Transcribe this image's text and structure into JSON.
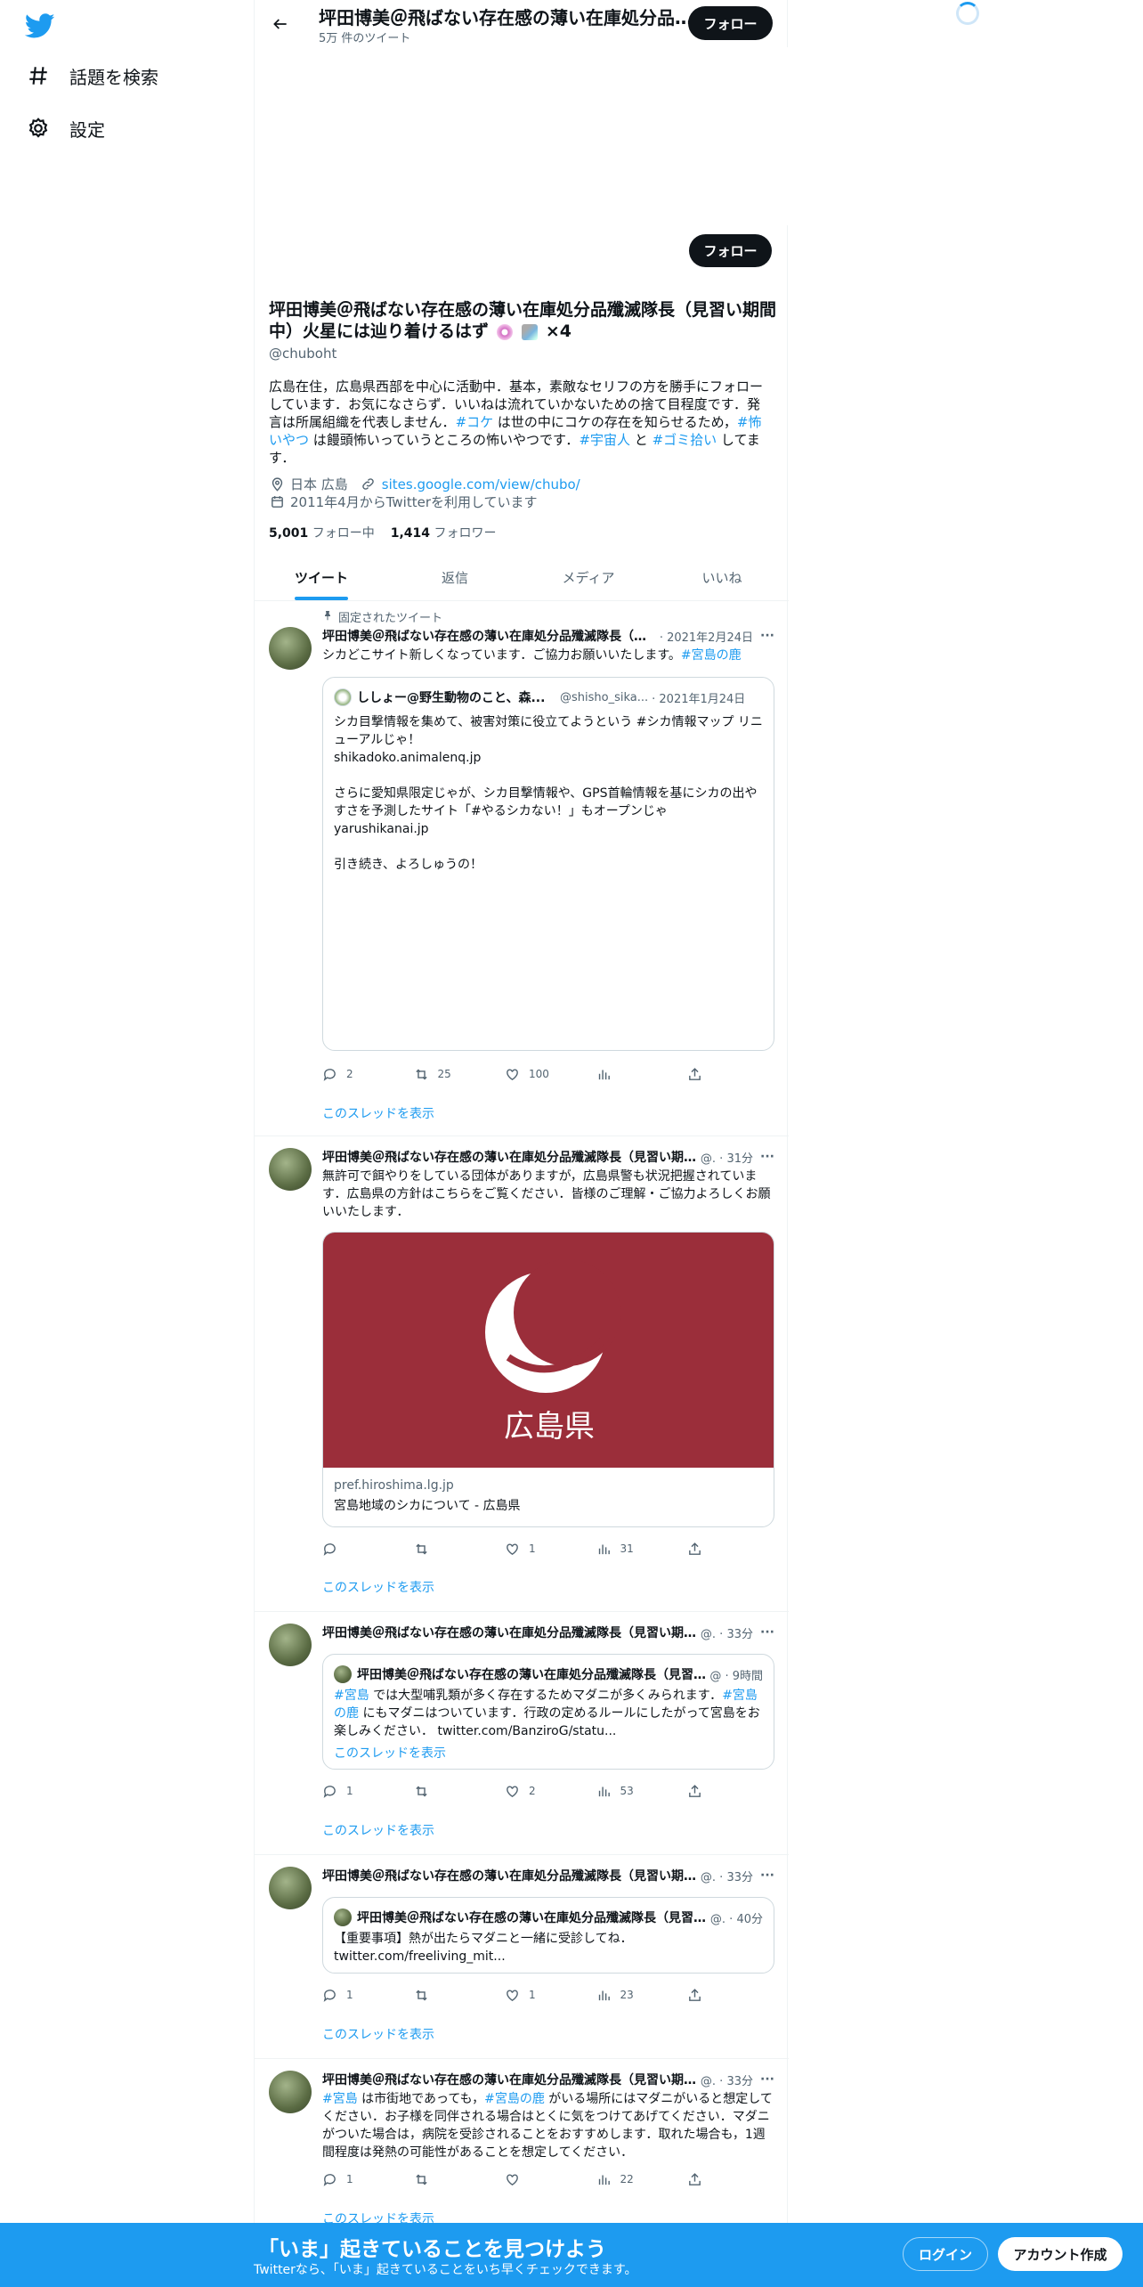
{
  "nav": {
    "logo": "twitter-bird-icon",
    "items": [
      {
        "icon": "hashtag-icon",
        "label": "話題を検索"
      },
      {
        "icon": "gear-icon",
        "label": "設定"
      }
    ]
  },
  "header": {
    "name": "坪田博美＠飛ばない存在感の薄い在庫処分品殲滅隊長（見習い期間中）火星には辿り着けるはず",
    "tweet_count": "5万 件のツイート",
    "follow_label": "フォロー"
  },
  "profile": {
    "name": "坪田博美＠飛ばない存在感の薄い在庫処分品殲滅隊長（見習い期間中）火星には辿り着けるはず",
    "name_suffix": "×4",
    "handle": "@chuboht",
    "follow_label": "フォロー",
    "bio": {
      "t1": "広島在住，広島県西部を中心に活動中．基本，素敵なセリフの方を勝手にフォローしています．お気になさらず．いいねは流れていかないための捨て目程度です．発言は所属組織を代表しません．",
      "tag1": "#コケ",
      "t2": " は世の中にコケの存在を知らせるため，",
      "tag2": "#怖いやつ",
      "t3": " は饅頭怖いっていうところの怖いやつです．",
      "tag3": "#宇宙人",
      "t4": " と ",
      "tag4": "#ゴミ拾い",
      "t5": " してます．"
    },
    "location": "日本 広島",
    "website": "sites.google.com/view/chubo/",
    "joined": "2011年4月からTwitterを利用しています",
    "following_count": "5,001",
    "following_label": "フォロー中",
    "followers_count": "1,414",
    "followers_label": "フォロワー"
  },
  "tabs": [
    "ツイート",
    "返信",
    "メディア",
    "いいね"
  ],
  "colors": {
    "accent": "#1d9bf0",
    "text": "#0f1419",
    "muted": "#536471",
    "card_red": "#9b2e3a"
  },
  "tweets": [
    {
      "pinned_label": "固定されたツイート",
      "name": "坪田博美＠飛ばない存在感の薄い在庫処分品殲滅隊長（見習い期間中）火星には辿り着けるはず",
      "time": "· 2021年2月24日",
      "text": "シカどこサイト新しくなっています．ご協力お願いいたします。",
      "tag": "#宮島の鹿",
      "quote": {
        "name": "ししょー@野生動物のこと、森...",
        "handle": "@shisho_sika...",
        "time": "· 2021年1月24日",
        "l1": "シカ目撃情報を集めて、被害対策に役立てようという #シカ情報マップ リニューアルじゃ！",
        "l2": "shikadoko.animalenq.jp",
        "l3": "さらに愛知県限定じゃが、シカ目撃情報や、GPS首輪情報を基にシカの出やすさを予測したサイト「#やるシカない！」もオープンじゃ",
        "l4": "yarushikanai.jp",
        "l5": "引き続き、よろしゅうの！"
      },
      "replies": "2",
      "retweets": "25",
      "likes": "100",
      "views": "",
      "thread": "このスレッドを表示"
    },
    {
      "name": "坪田博美＠飛ばない存在感の薄い在庫処分品殲滅隊長（見習い期間中）",
      "time": "@. · 31分",
      "text": "無許可で餌やりをしている団体がありますが，広島県警も状況把握されています．広島県の方針はこちらをご覧ください．皆様のご理解・ご協力よろしくお願いいたします．",
      "card": {
        "image_text": "広島県",
        "domain": "pref.hiroshima.lg.jp",
        "title": "宮島地域のシカについて - 広島県"
      },
      "replies": "",
      "retweets": "",
      "likes": "1",
      "views": "31",
      "thread": "このスレッドを表示"
    },
    {
      "name": "坪田博美＠飛ばない存在感の薄い在庫処分品殲滅隊長（見習い期間中）",
      "time": "@. · 33分",
      "quote": {
        "name": "坪田博美＠飛ばない存在感の薄い在庫処分品殲滅隊長（見習い期間中）",
        "time": "@ · 9時間",
        "tag1": "#宮島",
        "t1": " では大型哺乳類が多く存在するためマダニが多くみられます．",
        "tag2": "#宮島の鹿",
        "t2": " にもマダニはついています．行政の定めるルールにしたがって宮島をお楽しみください． twitter.com/BanziroG/statu...",
        "thread": "このスレッドを表示"
      },
      "replies": "1",
      "retweets": "",
      "likes": "2",
      "views": "53",
      "thread": "このスレッドを表示"
    },
    {
      "name": "坪田博美＠飛ばない存在感の薄い在庫処分品殲滅隊長（見習い期間中）",
      "time": "@. · 33分",
      "quote": {
        "name": "坪田博美＠飛ばない存在感の薄い在庫処分品殲滅隊長（見習い期間中）",
        "time": "@. · 40分",
        "l1": "【重要事項】熱が出たらマダニと一緒に受診してね．",
        "l2": "twitter.com/freeliving_mit..."
      },
      "replies": "1",
      "retweets": "",
      "likes": "1",
      "views": "23",
      "thread": "このスレッドを表示"
    },
    {
      "name": "坪田博美＠飛ばない存在感の薄い在庫処分品殲滅隊長（見習い期間中）",
      "time": "@. · 33分",
      "tag1": "#宮島",
      "t1": " は市街地であっても，",
      "tag2": "#宮島の鹿",
      "t2": " がいる場所にはマダニがいると想定してください．お子様を同伴される場合はとくに気をつけてあげてください．マダニがついた場合は，病院を受診されることをおすすめします．取れた場合も，1週間程度は発熱の可能性があることを想定してください．",
      "replies": "1",
      "retweets": "",
      "likes": "",
      "views": "22",
      "thread": "このスレッドを表示"
    }
  ],
  "bottom_bar": {
    "title": "「いま」起きていることを見つけよう",
    "subtitle": "Twitterなら、「いま」起きていることをいち早くチェックできます。",
    "login": "ログイン",
    "signup": "アカウント作成"
  }
}
